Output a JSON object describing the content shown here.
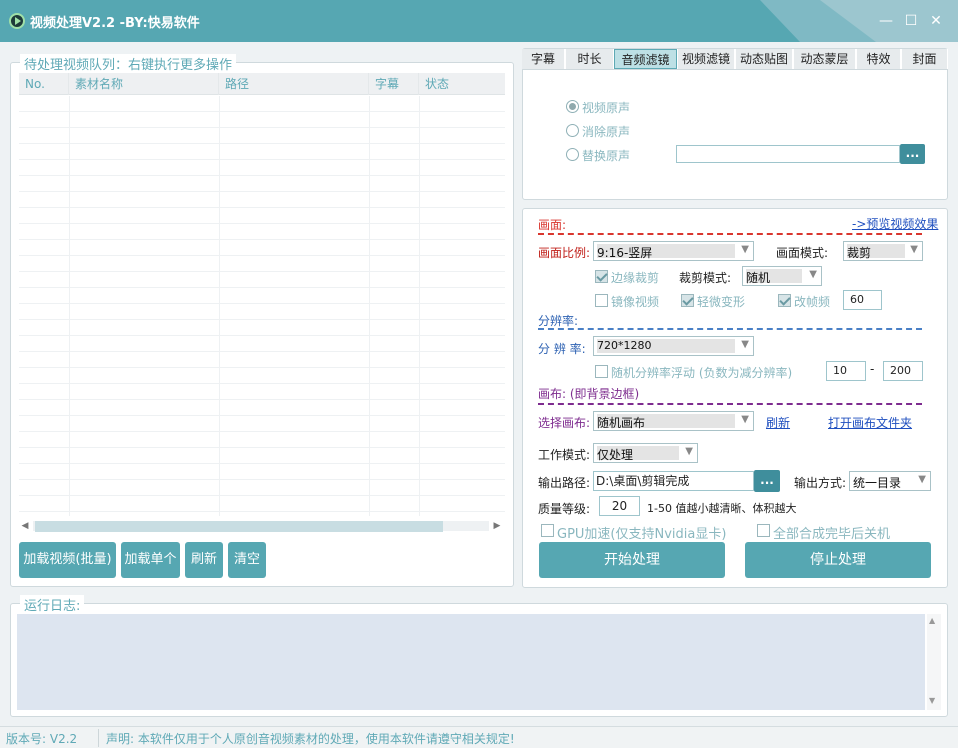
{
  "window": {
    "title": "视频处理V2.2 -BY:快易软件",
    "controls": {
      "minimize": "—",
      "maximize": "☐",
      "close": "✕"
    }
  },
  "queue": {
    "legend": "待处理视频队列：右键执行更多操作",
    "columns": [
      "No.",
      "素材名称",
      "路径",
      "字幕",
      "状态"
    ],
    "buttons": {
      "load_batch": "加载视频(批量)",
      "load_single": "加载单个",
      "refresh": "刷新",
      "clear": "清空"
    }
  },
  "tabs": [
    "字幕",
    "时长",
    "音频滤镜",
    "视频滤镜",
    "动态贴图",
    "动态蒙层",
    "特效",
    "封面"
  ],
  "active_tab": "音频滤镜",
  "audio": {
    "options": [
      {
        "label": "视频原声",
        "checked": true
      },
      {
        "label": "消除原声",
        "checked": false
      },
      {
        "label": "替换原声",
        "checked": false
      }
    ],
    "browse_label": "..."
  },
  "picture": {
    "section_title": "画面:",
    "preview_link": "->预览视频效果",
    "ratio_label": "画面比例:",
    "ratio_value": "9:16-竖屏",
    "mode_label": "画面模式:",
    "mode_value": "裁剪",
    "edge_crop_label": "边缘裁剪",
    "edge_crop_checked": true,
    "crop_mode_label": "裁剪模式:",
    "crop_mode_value": "随机",
    "mirror_label": "镜像视频",
    "mirror_checked": false,
    "slight_deform_label": "轻微变形",
    "slight_deform_checked": true,
    "fps_label": "改帧频",
    "fps_checked": true,
    "fps_value": "60"
  },
  "resolution": {
    "section_title": "分辨率:",
    "label": "分 辨 率:",
    "value": "720*1280",
    "random_float_label": "随机分辨率浮动 (负数为减分辨率)",
    "random_float_checked": false,
    "min": "10",
    "dash": "-",
    "max": "200"
  },
  "canvas": {
    "section_title": "画布: (即背景边框)",
    "select_label": "选择画布:",
    "select_value": "随机画布",
    "refresh_link": "刷新",
    "open_folder_link": "打开画布文件夹"
  },
  "output": {
    "work_mode_label": "工作模式:",
    "work_mode_value": "仅处理",
    "path_label": "输出路径:",
    "path_value": "D:\\桌面\\剪辑完成",
    "browse_label": "...",
    "method_label": "输出方式:",
    "method_value": "统一目录",
    "quality_label": "质量等级:",
    "quality_value": "20",
    "quality_hint": "1-50 值越小越清晰、体积越大",
    "gpu_label": "GPU加速(仅支持Nvidia显卡)",
    "gpu_checked": false,
    "shutdown_label": "全部合成完毕后关机",
    "shutdown_checked": false,
    "start_button": "开始处理",
    "stop_button": "停止处理"
  },
  "log": {
    "legend": "运行日志:"
  },
  "status": {
    "version": "版本号: V2.2",
    "notice": "声明: 本软件仅用于个人原创音视频素材的处理，使用本软件请遵守相关规定!"
  },
  "colors": {
    "accent": "#56a7b2",
    "light_accent": "#8ab7bf",
    "dash_red": "#d9362e",
    "dash_blue": "#4a80c6",
    "dash_purple": "#7e2c8f"
  }
}
